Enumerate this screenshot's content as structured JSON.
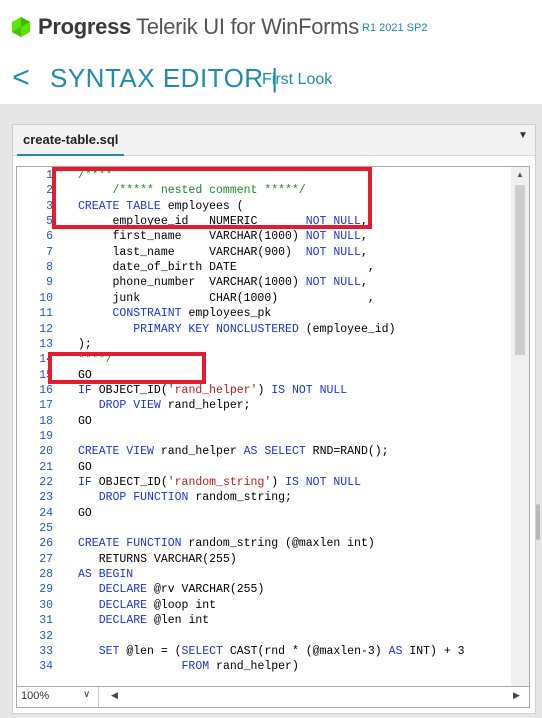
{
  "brand": {
    "company": "Progress",
    "product": "Telerik UI for WinForms",
    "version": "R1 2021 SP2",
    "logo_icon": "progress-logo-icon"
  },
  "header": {
    "back_icon": "chevron-left-icon",
    "back_glyph": "<",
    "title": "SYNTAX EDITOR |",
    "subtitle": "First Look"
  },
  "document": {
    "tab_label": "create-table.sql",
    "tab_menu_glyph": "▼"
  },
  "editor": {
    "lines": [
      {
        "n": "1",
        "parts": [
          {
            "t": "/****",
            "c": "cm"
          }
        ]
      },
      {
        "n": "2",
        "parts": [
          {
            "t": "     /***** nested comment *****/",
            "c": "cm"
          }
        ]
      },
      {
        "n": "3",
        "parts": [
          {
            "t": "CREATE TABLE ",
            "c": "kw"
          },
          {
            "t": "employees (",
            "c": ""
          }
        ]
      },
      {
        "n": "5",
        "parts": [
          {
            "t": "     employee_id   ",
            "c": ""
          },
          {
            "t": "NUMERIC       ",
            "c": ""
          },
          {
            "t": "NOT NULL",
            "c": "kw"
          },
          {
            "t": ",",
            "c": ""
          }
        ]
      },
      {
        "n": "6",
        "parts": [
          {
            "t": "     first_name    ",
            "c": ""
          },
          {
            "t": "VARCHAR(1000) ",
            "c": ""
          },
          {
            "t": "NOT NULL",
            "c": "kw"
          },
          {
            "t": ",",
            "c": ""
          }
        ]
      },
      {
        "n": "7",
        "parts": [
          {
            "t": "     last_name     ",
            "c": ""
          },
          {
            "t": "VARCHAR(900)  ",
            "c": ""
          },
          {
            "t": "NOT NULL",
            "c": "kw"
          },
          {
            "t": ",",
            "c": ""
          }
        ]
      },
      {
        "n": "8",
        "parts": [
          {
            "t": "     date_of_birth ",
            "c": ""
          },
          {
            "t": "DATE                   ,",
            "c": ""
          }
        ]
      },
      {
        "n": "9",
        "parts": [
          {
            "t": "     phone_number  ",
            "c": ""
          },
          {
            "t": "VARCHAR(1000) ",
            "c": ""
          },
          {
            "t": "NOT NULL",
            "c": "kw"
          },
          {
            "t": ",",
            "c": ""
          }
        ]
      },
      {
        "n": "10",
        "parts": [
          {
            "t": "     junk          ",
            "c": ""
          },
          {
            "t": "CHAR(1000)             ,",
            "c": ""
          }
        ]
      },
      {
        "n": "11",
        "parts": [
          {
            "t": "     ",
            "c": ""
          },
          {
            "t": "CONSTRAINT ",
            "c": "kw"
          },
          {
            "t": "employees_pk",
            "c": ""
          }
        ]
      },
      {
        "n": "12",
        "parts": [
          {
            "t": "        ",
            "c": ""
          },
          {
            "t": "PRIMARY KEY NONCLUSTERED ",
            "c": "kw"
          },
          {
            "t": "(employee_id)",
            "c": ""
          }
        ]
      },
      {
        "n": "13",
        "parts": [
          {
            "t": ");",
            "c": ""
          }
        ]
      },
      {
        "n": "14",
        "parts": [
          {
            "t": "****/",
            "c": "cm"
          }
        ]
      },
      {
        "n": "15",
        "parts": [
          {
            "t": "GO",
            "c": ""
          }
        ]
      },
      {
        "n": "16",
        "parts": [
          {
            "t": "IF ",
            "c": "kw"
          },
          {
            "t": "OBJECT_ID(",
            "c": ""
          },
          {
            "t": "'rand_helper'",
            "c": "st"
          },
          {
            "t": ") ",
            "c": ""
          },
          {
            "t": "IS NOT NULL",
            "c": "kw"
          }
        ]
      },
      {
        "n": "17",
        "parts": [
          {
            "t": "   ",
            "c": ""
          },
          {
            "t": "DROP VIEW ",
            "c": "kw"
          },
          {
            "t": "rand_helper;",
            "c": ""
          }
        ]
      },
      {
        "n": "18",
        "parts": [
          {
            "t": "GO",
            "c": ""
          }
        ]
      },
      {
        "n": "19",
        "parts": []
      },
      {
        "n": "20",
        "parts": [
          {
            "t": "CREATE VIEW ",
            "c": "kw"
          },
          {
            "t": "rand_helper ",
            "c": ""
          },
          {
            "t": "AS SELECT ",
            "c": "kw"
          },
          {
            "t": "RND=RAND();",
            "c": ""
          }
        ]
      },
      {
        "n": "21",
        "parts": [
          {
            "t": "GO",
            "c": ""
          }
        ]
      },
      {
        "n": "22",
        "parts": [
          {
            "t": "IF ",
            "c": "kw"
          },
          {
            "t": "OBJECT_ID(",
            "c": ""
          },
          {
            "t": "'random_string'",
            "c": "st"
          },
          {
            "t": ") ",
            "c": ""
          },
          {
            "t": "IS NOT NULL",
            "c": "kw"
          }
        ]
      },
      {
        "n": "23",
        "parts": [
          {
            "t": "   ",
            "c": ""
          },
          {
            "t": "DROP FUNCTION ",
            "c": "kw"
          },
          {
            "t": "random_string;",
            "c": ""
          }
        ]
      },
      {
        "n": "24",
        "parts": [
          {
            "t": "GO",
            "c": ""
          }
        ]
      },
      {
        "n": "25",
        "parts": []
      },
      {
        "n": "26",
        "parts": [
          {
            "t": "CREATE FUNCTION ",
            "c": "kw"
          },
          {
            "t": "random_string (@maxlen int)",
            "c": ""
          }
        ]
      },
      {
        "n": "27",
        "parts": [
          {
            "t": "   RETURNS VARCHAR(255)",
            "c": ""
          }
        ]
      },
      {
        "n": "28",
        "parts": [
          {
            "t": "AS BEGIN",
            "c": "kw"
          }
        ]
      },
      {
        "n": "29",
        "parts": [
          {
            "t": "   ",
            "c": ""
          },
          {
            "t": "DECLARE ",
            "c": "kw"
          },
          {
            "t": "@rv VARCHAR(255)",
            "c": ""
          }
        ]
      },
      {
        "n": "30",
        "parts": [
          {
            "t": "   ",
            "c": ""
          },
          {
            "t": "DECLARE ",
            "c": "kw"
          },
          {
            "t": "@loop int",
            "c": ""
          }
        ]
      },
      {
        "n": "31",
        "parts": [
          {
            "t": "   ",
            "c": ""
          },
          {
            "t": "DECLARE ",
            "c": "kw"
          },
          {
            "t": "@len int",
            "c": ""
          }
        ]
      },
      {
        "n": "32",
        "parts": []
      },
      {
        "n": "33",
        "parts": [
          {
            "t": "   ",
            "c": ""
          },
          {
            "t": "SET ",
            "c": "kw"
          },
          {
            "t": "@len = (",
            "c": ""
          },
          {
            "t": "SELECT ",
            "c": "kw"
          },
          {
            "t": "CAST(rnd * (@maxlen-3) ",
            "c": ""
          },
          {
            "t": "AS ",
            "c": "kw"
          },
          {
            "t": "INT) + 3",
            "c": ""
          }
        ]
      },
      {
        "n": "34",
        "parts": [
          {
            "t": "               ",
            "c": ""
          },
          {
            "t": "FROM ",
            "c": "kw"
          },
          {
            "t": "rand_helper)",
            "c": ""
          }
        ]
      }
    ]
  },
  "footer": {
    "zoom_value": "100%",
    "zoom_arrow": "∨",
    "scroll_left_glyph": "◀",
    "scroll_right_glyph": "▶",
    "scroll_up_glyph": "▲"
  },
  "colors": {
    "accent": "#1e8bb0",
    "keyword": "#1a35d9",
    "comment": "#1f8a2a",
    "string": "#b71c1c",
    "line_number": "#1f5bc8",
    "highlight": "#e41c2d"
  }
}
